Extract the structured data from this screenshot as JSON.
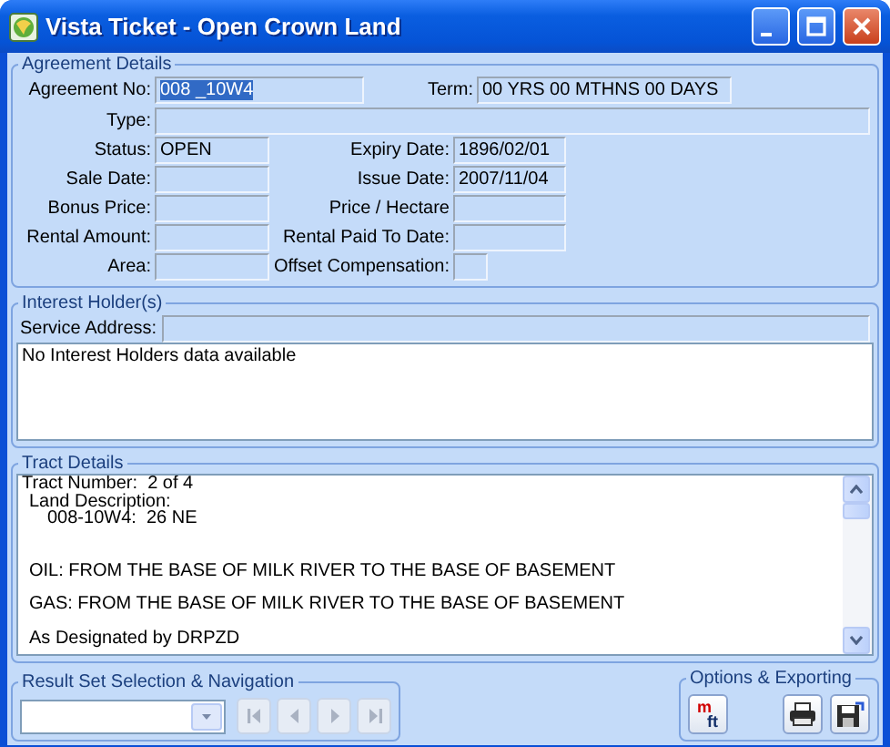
{
  "window": {
    "title": "Vista Ticket - Open Crown Land"
  },
  "agreement_details": {
    "title": "Agreement Details",
    "agreement_no": {
      "label": "Agreement No:",
      "value": "008 _10W4",
      "text_selected": true
    },
    "term": {
      "label": "Term:",
      "value": "00 YRS 00 MTHNS 00 DAYS"
    },
    "type": {
      "label": "Type:"
    },
    "rows": [
      {
        "left": {
          "label": "Status:",
          "value": "OPEN"
        },
        "right": {
          "label": "Expiry Date:",
          "value": "1896/02/01"
        }
      },
      {
        "left": {
          "label": "Sale Date:"
        },
        "right": {
          "label": "Issue Date:",
          "value": "2007/11/04"
        }
      },
      {
        "left": {
          "label": "Bonus Price:"
        },
        "right": {
          "label": "Price / Hectare"
        }
      },
      {
        "left": {
          "label": "Rental Amount:"
        },
        "right": {
          "label": "Rental Paid To Date:"
        }
      },
      {
        "left": {
          "label": "Area:"
        },
        "right": {
          "label": "Offset Compensation:"
        }
      }
    ]
  },
  "interest_holders": {
    "title": "Interest Holder(s)",
    "service_address": {
      "label": "Service Address:"
    },
    "list": [
      "No Interest Holders data available"
    ]
  },
  "tract_details": {
    "title": "Tract Details",
    "lines": [
      {
        "kind": "line",
        "text": "Tract Number:  2 of 4",
        "children": [
          {
            "kind": "line",
            "text": "Land Description:",
            "children": [
              {
                "kind": "indented",
                "text": "008-10W4:  26 NE"
              }
            ]
          },
          {
            "kind": "section",
            "text": "OIL: FROM THE BASE OF MILK RIVER TO THE BASE OF BASEMENT"
          },
          {
            "kind": "paragraph",
            "text": "GAS: FROM THE BASE OF MILK RIVER TO THE BASE OF BASEMENT"
          },
          {
            "kind": "paragraph",
            "text": "As Designated by DRPZD"
          }
        ]
      }
    ]
  },
  "navigation": {
    "title": "Result Set Selection & Navigation",
    "buttons": [
      {
        "kind": "first",
        "disabled": true
      },
      {
        "kind": "previous",
        "disabled": true
      },
      {
        "kind": "next",
        "disabled": true
      },
      {
        "kind": "last",
        "disabled": true
      }
    ]
  },
  "options": {
    "title": "Options & Exporting",
    "units_button": {
      "top": "m",
      "bottom": "ft"
    }
  }
}
